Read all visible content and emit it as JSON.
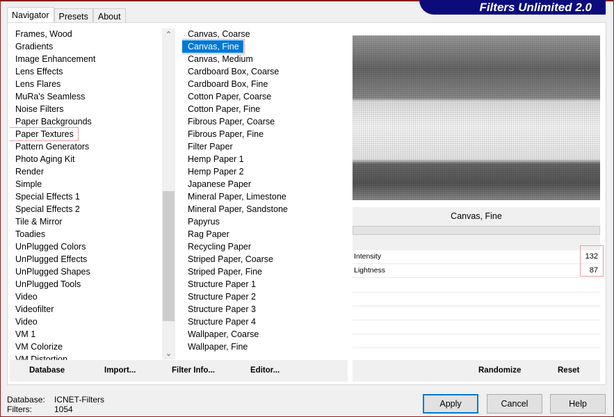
{
  "app": {
    "title": "Filters Unlimited 2.0"
  },
  "tabs": [
    {
      "label": "Navigator"
    },
    {
      "label": "Presets"
    },
    {
      "label": "About"
    }
  ],
  "categories": [
    "Frames, Wood",
    "Gradients",
    "Image Enhancement",
    "Lens Effects",
    "Lens Flares",
    "MuRa's Seamless",
    "Noise Filters",
    "Paper Backgrounds",
    "Paper Textures",
    "Pattern Generators",
    "Photo Aging Kit",
    "Render",
    "Simple",
    "Special Effects 1",
    "Special Effects 2",
    "Tile & Mirror",
    "Toadies",
    "UnPlugged Colors",
    "UnPlugged Effects",
    "UnPlugged Shapes",
    "UnPlugged Tools",
    "Video",
    "Videofilter",
    "Video",
    "VM 1",
    "VM Colorize",
    "VM Distortion"
  ],
  "selected_category": "Paper Textures",
  "filters": [
    "Canvas, Coarse",
    "Canvas, Fine",
    "Canvas, Medium",
    "Cardboard Box, Coarse",
    "Cardboard Box, Fine",
    "Cotton Paper, Coarse",
    "Cotton Paper, Fine",
    "Fibrous Paper, Coarse",
    "Fibrous Paper, Fine",
    "Filter Paper",
    "Hemp Paper 1",
    "Hemp Paper 2",
    "Japanese Paper",
    "Mineral Paper, Limestone",
    "Mineral Paper, Sandstone",
    "Papyrus",
    "Rag Paper",
    "Recycling Paper",
    "Striped Paper, Coarse",
    "Striped Paper, Fine",
    "Structure Paper 1",
    "Structure Paper 2",
    "Structure Paper 3",
    "Structure Paper 4",
    "Wallpaper, Coarse",
    "Wallpaper, Fine"
  ],
  "selected_filter": "Canvas, Fine",
  "filter_panel": {
    "name": "Canvas, Fine",
    "params": [
      {
        "label": "Intensity",
        "value": "132",
        "level": 132
      },
      {
        "label": "Lightness",
        "value": "87",
        "level": 87
      }
    ]
  },
  "left_buttons": {
    "database": "Database",
    "import": "Import...",
    "filter_info": "Filter Info...",
    "editor": "Editor..."
  },
  "right_buttons": {
    "randomize": "Randomize",
    "reset": "Reset"
  },
  "status": {
    "database_label": "Database:",
    "database_value": "ICNET-Filters",
    "filters_label": "Filters:",
    "filters_value": "1054"
  },
  "dialog_buttons": {
    "apply": "Apply",
    "cancel": "Cancel",
    "help": "Help"
  },
  "colors": {
    "frame": "#8b1a1a",
    "logo_bg": "#0b0b7a",
    "selection": "#0078d7",
    "highlight_box": "#e8a0a0"
  }
}
